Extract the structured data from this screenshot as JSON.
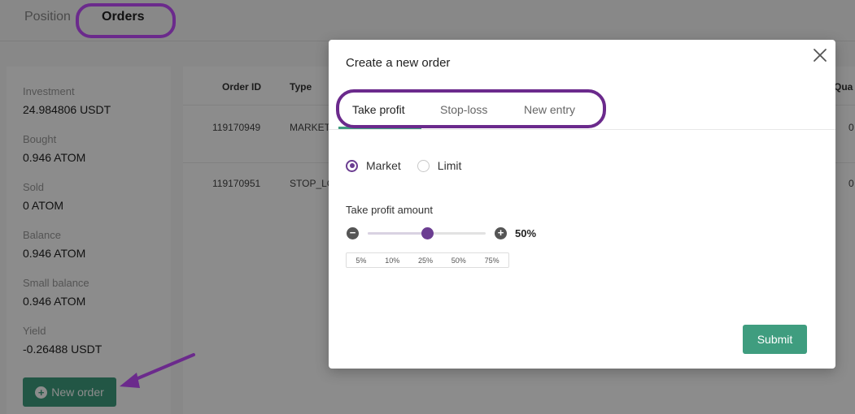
{
  "page_tabs": [
    "Position",
    "Orders"
  ],
  "stats": [
    {
      "label": "Investment",
      "value": "24.984806 USDT"
    },
    {
      "label": "Bought",
      "value": "0.946 ATOM"
    },
    {
      "label": "Sold",
      "value": "0 ATOM"
    },
    {
      "label": "Balance",
      "value": "0.946 ATOM"
    },
    {
      "label": "Small balance",
      "value": "0.946 ATOM"
    },
    {
      "label": "Yield",
      "value": "-0.26488 USDT"
    }
  ],
  "new_order_label": "New order",
  "table": {
    "headers": [
      "Order ID",
      "Type",
      "Qua"
    ],
    "rows": [
      {
        "order_id": "119170949",
        "type": "MARKET",
        "qty": "0"
      },
      {
        "order_id": "119170951",
        "type": "STOP_LC",
        "qty": "0"
      }
    ]
  },
  "modal": {
    "title": "Create a new order",
    "tabs": [
      "Take profit",
      "Stop-loss",
      "New entry"
    ],
    "active_tab": "Take profit",
    "order_types": [
      "Market",
      "Limit"
    ],
    "selected_type": "Market",
    "amount_label": "Take profit amount",
    "amount_value": "50%",
    "amount_fraction": 0.5,
    "presets": [
      "5%",
      "10%",
      "25%",
      "50%",
      "75%"
    ],
    "submit_label": "Submit"
  },
  "colors": {
    "accent": "#3f9d7f",
    "purple": "#6b3d91",
    "annotation": "#6b2a8c"
  }
}
